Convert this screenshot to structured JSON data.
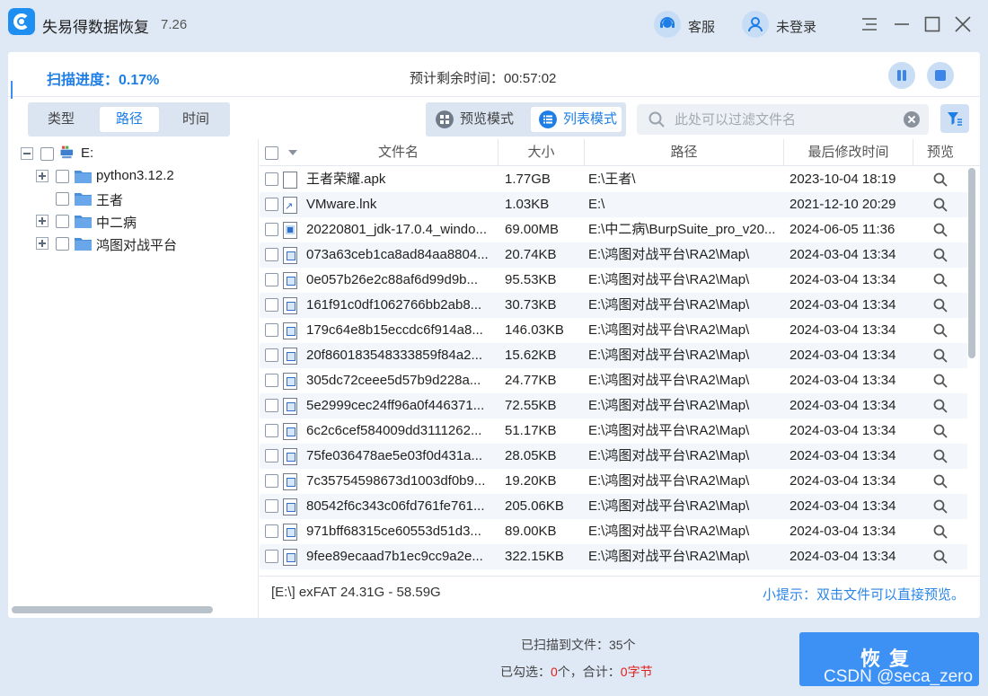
{
  "app": {
    "title": "失易得数据恢复",
    "version": "7.26"
  },
  "titlebar": {
    "service_label": "客服",
    "login_label": "未登录"
  },
  "scan": {
    "progress_label": "扫描进度：0.17%",
    "remaining_label": "预计剩余时间：00:57:02"
  },
  "view_tabs": [
    "类型",
    "路径",
    "时间"
  ],
  "active_view_tab": "路径",
  "mode_tabs": {
    "preview": "预览模式",
    "list": "列表模式"
  },
  "search": {
    "placeholder": "此处可以过滤文件名"
  },
  "tree": {
    "root": "E:",
    "children": [
      "python3.12.2",
      "王者",
      "中二病",
      "鸿图对战平台"
    ]
  },
  "table": {
    "headers": [
      "文件名",
      "大小",
      "路径",
      "最后修改时间",
      "预览"
    ],
    "rows": [
      {
        "name": "王者荣耀.apk",
        "size": "1.77GB",
        "path": "E:\\王者\\",
        "modified": "2023-10-04  18:19",
        "icon": "file-icon"
      },
      {
        "name": "VMware.lnk",
        "size": "1.03KB",
        "path": "E:\\",
        "modified": "2021-12-10  20:29",
        "icon": "shortcut-icon"
      },
      {
        "name": "20220801_jdk-17.0.4_windo...",
        "size": "69.00MB",
        "path": "E:\\中二病\\BurpSuite_pro_v20...",
        "modified": "2024-06-05  11:36",
        "icon": "installer-icon"
      },
      {
        "name": "073a63ceb1ca8ad84aa8804...",
        "size": "20.74KB",
        "path": "E:\\鸿图对战平台\\RA2\\Map\\",
        "modified": "2024-03-04  13:34",
        "icon": "image-file-icon"
      },
      {
        "name": "0e057b26e2c88af6d99d9b...",
        "size": "95.53KB",
        "path": "E:\\鸿图对战平台\\RA2\\Map\\",
        "modified": "2024-03-04  13:34",
        "icon": "image-file-icon"
      },
      {
        "name": "161f91c0df1062766bb2ab8...",
        "size": "30.73KB",
        "path": "E:\\鸿图对战平台\\RA2\\Map\\",
        "modified": "2024-03-04  13:34",
        "icon": "image-file-icon"
      },
      {
        "name": "179c64e8b15eccdc6f914a8...",
        "size": "146.03KB",
        "path": "E:\\鸿图对战平台\\RA2\\Map\\",
        "modified": "2024-03-04  13:34",
        "icon": "image-file-icon"
      },
      {
        "name": "20f860183548333859f84a2...",
        "size": "15.62KB",
        "path": "E:\\鸿图对战平台\\RA2\\Map\\",
        "modified": "2024-03-04  13:34",
        "icon": "image-file-icon"
      },
      {
        "name": "305dc72ceee5d57b9d228a...",
        "size": "24.77KB",
        "path": "E:\\鸿图对战平台\\RA2\\Map\\",
        "modified": "2024-03-04  13:34",
        "icon": "image-file-icon"
      },
      {
        "name": "5e2999cec24ff96a0f446371...",
        "size": "72.55KB",
        "path": "E:\\鸿图对战平台\\RA2\\Map\\",
        "modified": "2024-03-04  13:34",
        "icon": "image-file-icon"
      },
      {
        "name": "6c2c6cef584009dd3111262...",
        "size": "51.17KB",
        "path": "E:\\鸿图对战平台\\RA2\\Map\\",
        "modified": "2024-03-04  13:34",
        "icon": "image-file-icon"
      },
      {
        "name": "75fe036478ae5e03f0d431a...",
        "size": "28.05KB",
        "path": "E:\\鸿图对战平台\\RA2\\Map\\",
        "modified": "2024-03-04  13:34",
        "icon": "image-file-icon"
      },
      {
        "name": "7c35754598673d1003df0b9...",
        "size": "19.20KB",
        "path": "E:\\鸿图对战平台\\RA2\\Map\\",
        "modified": "2024-03-04  13:34",
        "icon": "image-file-icon"
      },
      {
        "name": "80542f6c343c06fd761fe761...",
        "size": "205.06KB",
        "path": "E:\\鸿图对战平台\\RA2\\Map\\",
        "modified": "2024-03-04  13:34",
        "icon": "image-file-icon"
      },
      {
        "name": "971bff68315ce60553d51d3...",
        "size": "89.00KB",
        "path": "E:\\鸿图对战平台\\RA2\\Map\\",
        "modified": "2024-03-04  13:34",
        "icon": "image-file-icon"
      },
      {
        "name": "9fee89ecaad7b1ec9cc9a2e...",
        "size": "322.15KB",
        "path": "E:\\鸿图对战平台\\RA2\\Map\\",
        "modified": "2024-03-04  13:34",
        "icon": "image-file-icon"
      }
    ]
  },
  "status": {
    "fs_info": "[E:\\] exFAT 24.31G - 58.59G",
    "tip": "小提示：双击文件可以直接预览。"
  },
  "footer": {
    "scanned_label": "已扫描到文件：35个",
    "checked_prefix": "已勾选：",
    "checked_count": "0",
    "checked_mid": "个，合计：",
    "checked_total": "0字节",
    "recover_label": "恢复"
  },
  "watermark": "CSDN @seca_zero",
  "colors": {
    "accent": "#1d7ee6",
    "recover": "#3d91f4",
    "warning": "#e0201a",
    "background": "#dfe9f5"
  }
}
